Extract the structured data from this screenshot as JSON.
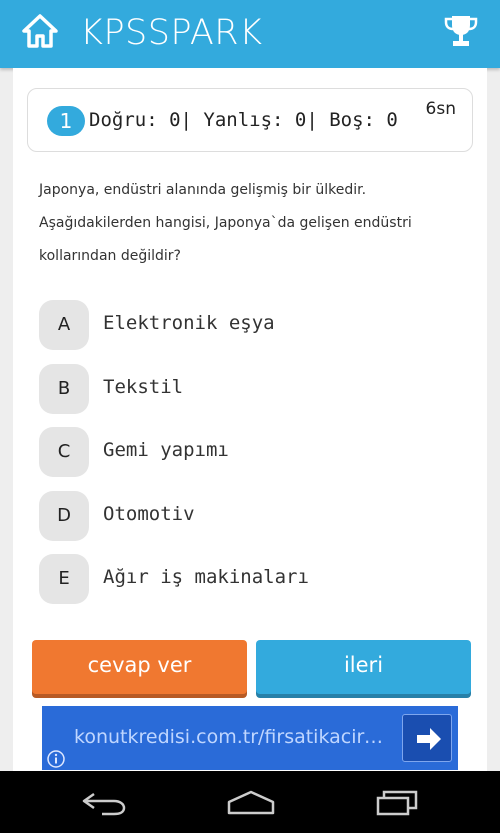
{
  "app": {
    "title": "KPSSPARK",
    "home_icon": "home-icon",
    "trophy_icon": "trophy-icon",
    "accent": "#33aadd"
  },
  "status": {
    "question_number": "1",
    "stats_text": "Doğru: 0| Yanlış: 0| Boş: 0",
    "timer": "6sn"
  },
  "question": {
    "lines": [
      "Japonya, endüstri alanında gelişmiş bir ülkedir.",
      "Aşağıdakilerden hangisi, Japonya`da gelişen endüstri",
      "kollarından değildir?"
    ]
  },
  "options": [
    {
      "letter": "A",
      "text": "Elektronik eşya"
    },
    {
      "letter": "B",
      "text": "Tekstil"
    },
    {
      "letter": "C",
      "text": "Gemi yapımı"
    },
    {
      "letter": "D",
      "text": "Otomotiv"
    },
    {
      "letter": "E",
      "text": "Ağır iş makinaları"
    }
  ],
  "buttons": {
    "answer_label": "cevap ver",
    "answer_color": "#f07830",
    "next_label": "ileri",
    "next_color": "#33aadd"
  },
  "ad": {
    "text": "konutkredisi.com.tr/firsatikacirmayin",
    "arrow_icon": "arrow-right-icon",
    "info_icon": "info-icon"
  },
  "navbar": {
    "back_icon": "back-icon",
    "home_icon": "home-outline-icon",
    "recents_icon": "recents-icon"
  }
}
